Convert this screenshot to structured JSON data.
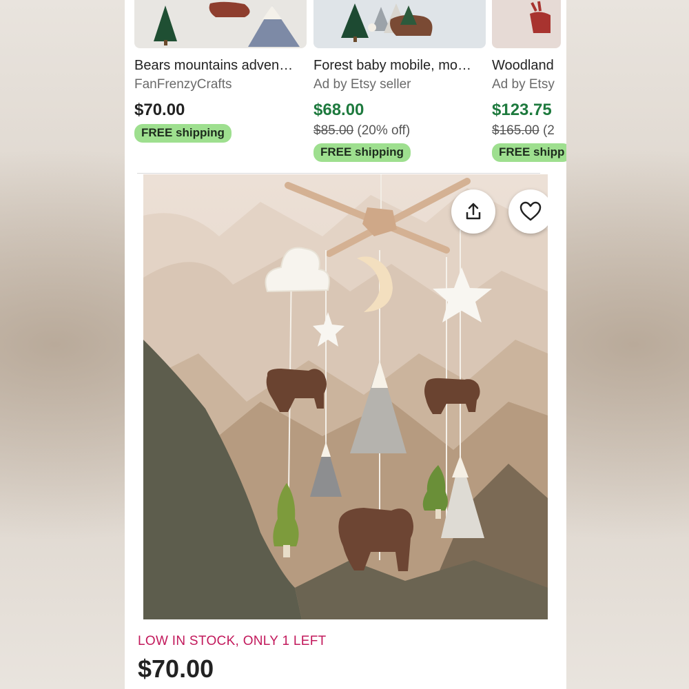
{
  "related_listings": [
    {
      "title": "Bears mountains adven…",
      "seller": "FanFrenzyCrafts",
      "price": "$70.00",
      "original_price": "",
      "discount": "",
      "shipping_badge": "FREE shipping"
    },
    {
      "title": "Forest baby mobile, mo…",
      "seller": "Ad by Etsy seller",
      "price": "$68.00",
      "original_price": "$85.00",
      "discount": "(20% off)",
      "shipping_badge": "FREE shipping"
    },
    {
      "title": "Woodland",
      "seller": "Ad by Etsy",
      "price": "$123.75",
      "original_price": "$165.00",
      "discount": "(2",
      "shipping_badge": "FREE shipp"
    }
  ],
  "listing": {
    "share_icon": "share-icon",
    "favorite_icon": "heart-icon",
    "stock_notice": "LOW IN STOCK, ONLY 1 LEFT",
    "price": "$70.00"
  },
  "colors": {
    "sale_price": "#1e7a3e",
    "shipping_badge": "#9edf8f",
    "stock_notice": "#c2185b"
  }
}
